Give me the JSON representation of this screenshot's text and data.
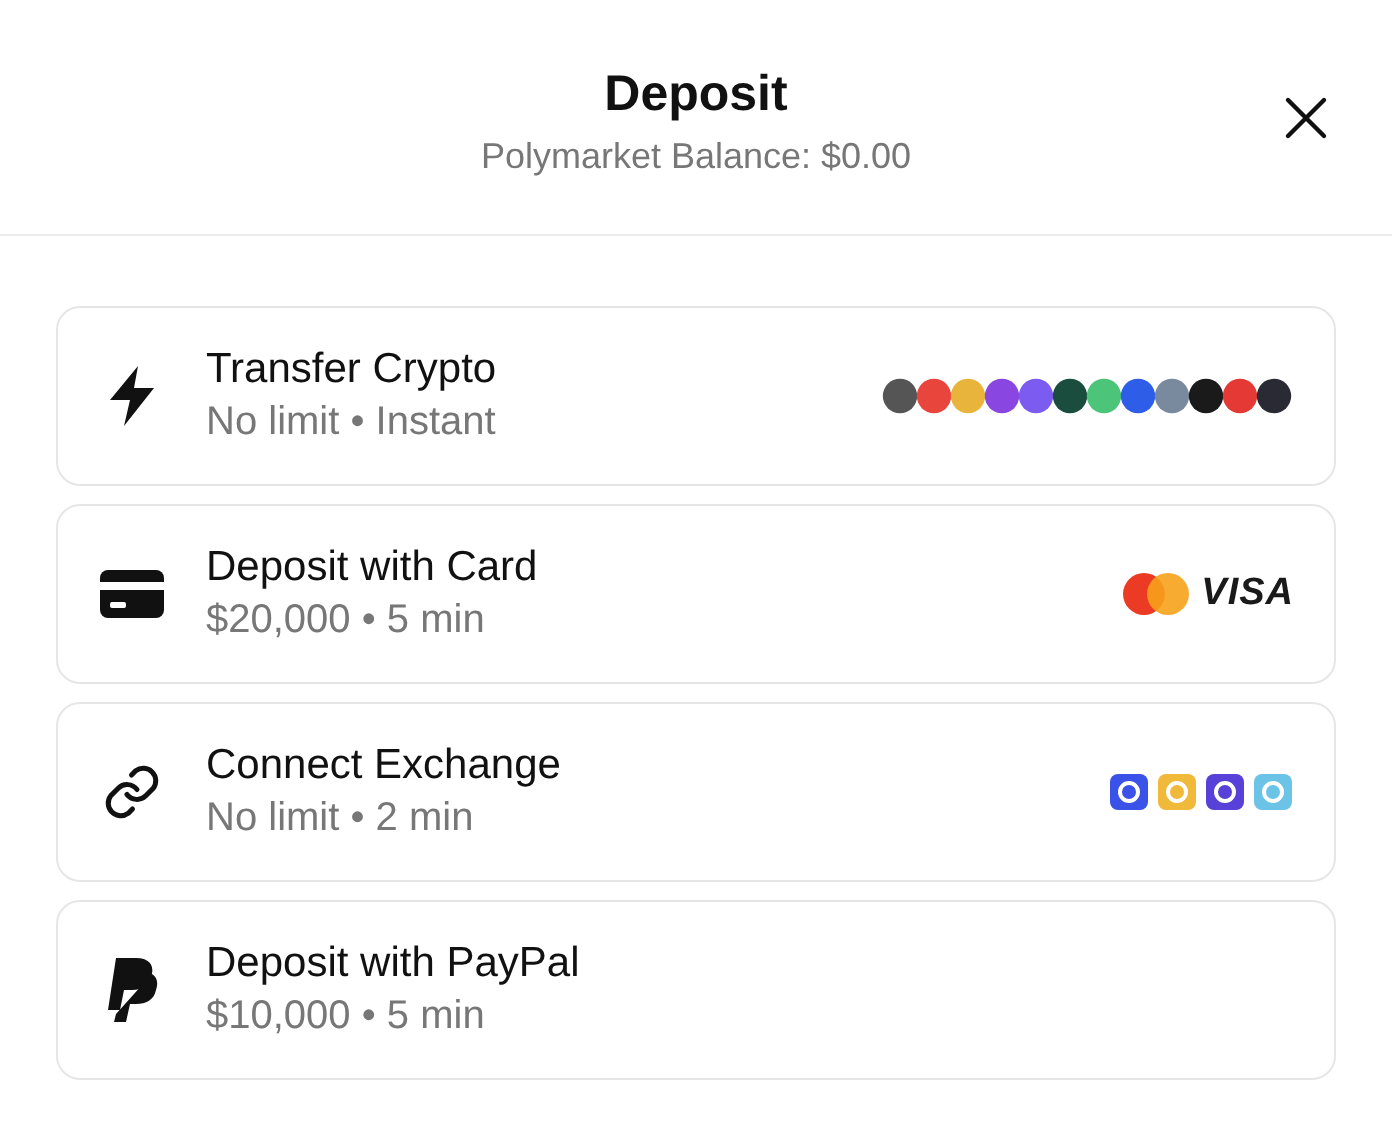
{
  "header": {
    "title": "Deposit",
    "subtitle": "Polymarket Balance: $0.00"
  },
  "methods": [
    {
      "kind": "crypto",
      "title": "Transfer Crypto",
      "detail": "No limit • Instant"
    },
    {
      "kind": "card",
      "title": "Deposit with Card",
      "detail": "$20,000 • 5 min",
      "logo_text": "VISA"
    },
    {
      "kind": "exchange",
      "title": "Connect Exchange",
      "detail": "No limit • 2 min"
    },
    {
      "kind": "paypal",
      "title": "Deposit with PayPal",
      "detail": "$10,000 • 5 min"
    }
  ]
}
